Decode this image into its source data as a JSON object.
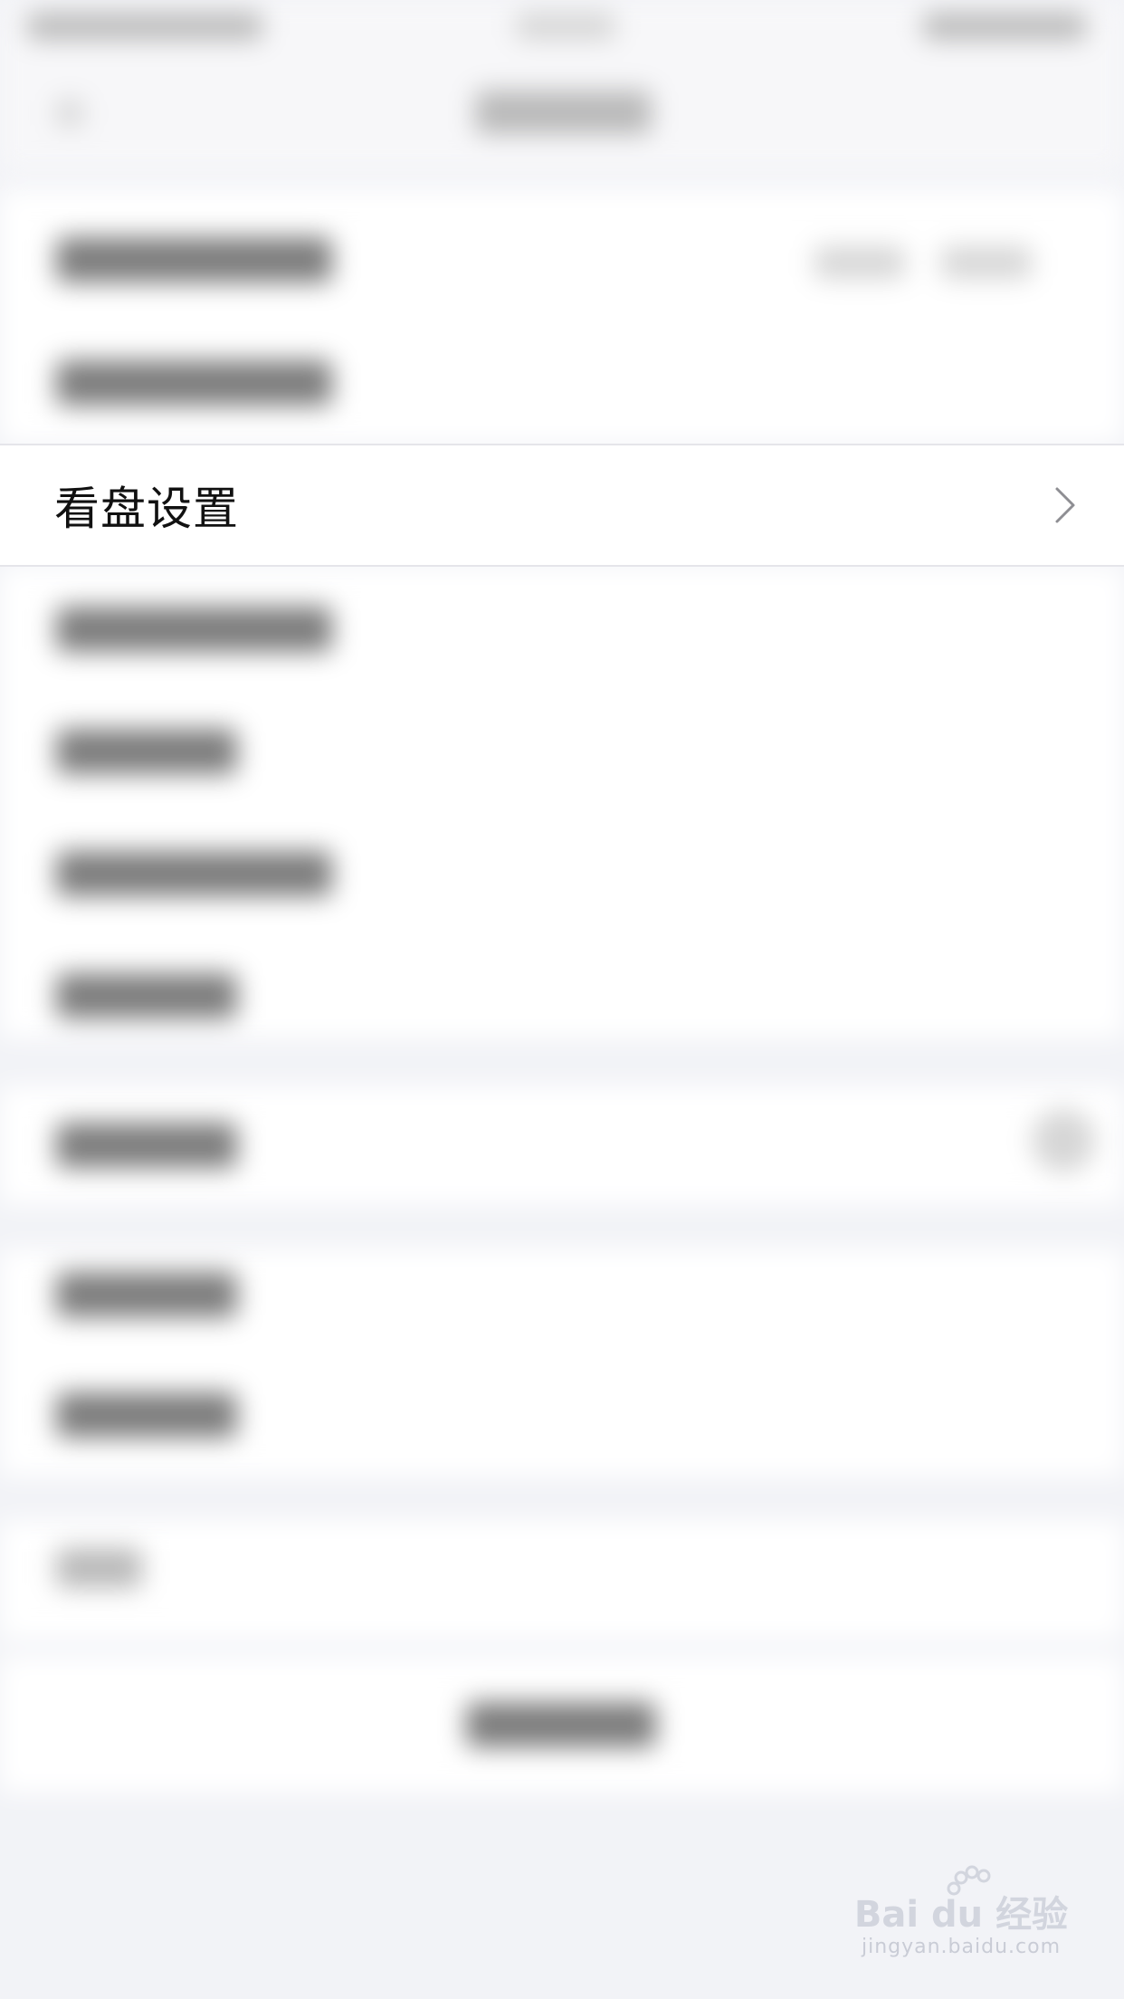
{
  "settings_row": {
    "label": "看盘设置"
  },
  "watermark": {
    "brand": "Bai du 经验",
    "url": "jingyan.baidu.com"
  },
  "icons": {
    "row_chevron": "chevron-right-icon",
    "watermark_logo": "baidu-paw-icon"
  },
  "colors": {
    "page_background": "#f2f3f7",
    "row_background": "#ffffff",
    "row_text": "#111111",
    "chevron": "#8e8e93",
    "watermark": "#c9ccd6"
  }
}
